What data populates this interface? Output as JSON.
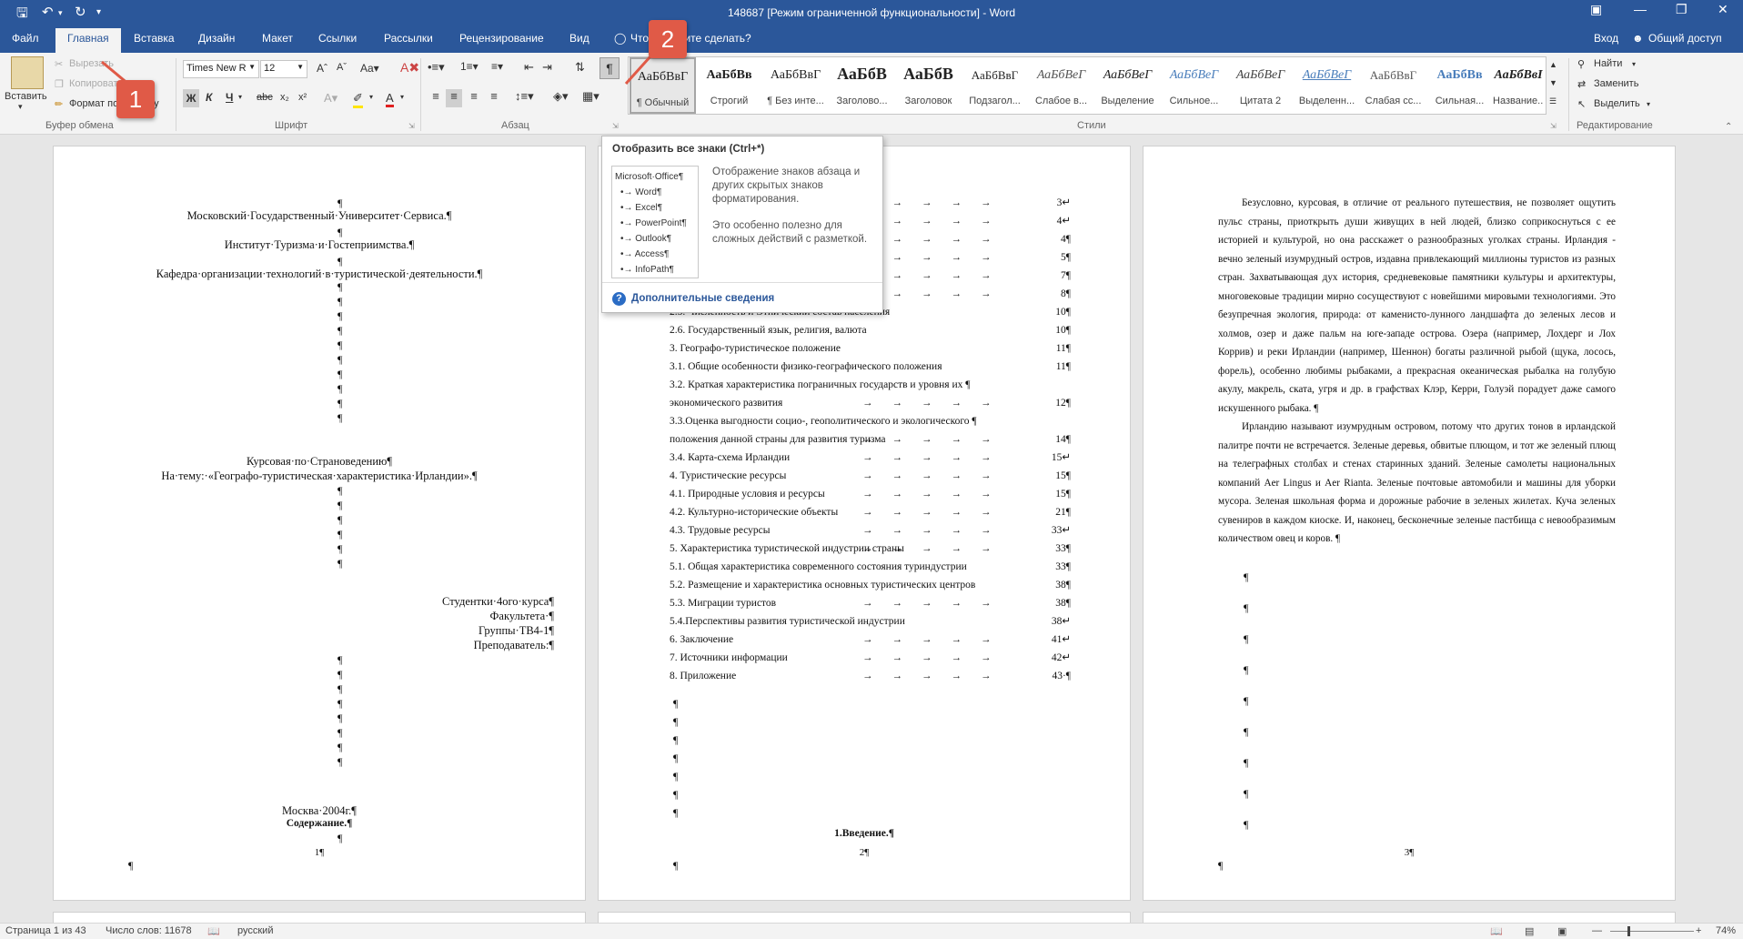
{
  "window": {
    "title": "148687 [Режим ограниченной функциональности] - Word"
  },
  "qat": {
    "save_icon": "save-icon",
    "undo_icon": "undo-icon",
    "redo_icon": "redo-icon"
  },
  "tabs": [
    {
      "label": "Файл"
    },
    {
      "label": "Главная"
    },
    {
      "label": "Вставка"
    },
    {
      "label": "Дизайн"
    },
    {
      "label": "Макет"
    },
    {
      "label": "Ссылки"
    },
    {
      "label": "Рассылки"
    },
    {
      "label": "Рецензирование"
    },
    {
      "label": "Вид"
    }
  ],
  "tell_me": "Что вы хотите сделать?",
  "signin": "Вход",
  "share": "Общий доступ",
  "clipboard": {
    "paste": "Вставить",
    "cut": "Вырезать",
    "copy": "Копировать",
    "format_painter": "Формат по образцу",
    "group": "Буфер обмена"
  },
  "font": {
    "name": "Times New R",
    "size": "12",
    "group": "Шрифт"
  },
  "paragraph": {
    "group": "Абзац"
  },
  "styles": {
    "group": "Стили",
    "items": [
      {
        "preview": "АаБбВвГ",
        "name": "¶ Обычный"
      },
      {
        "preview": "АаБбВв",
        "name": "Строгий"
      },
      {
        "preview": "АаБбВвГ",
        "name": "¶ Без инте..."
      },
      {
        "preview": "АаБбВ",
        "name": "Заголово..."
      },
      {
        "preview": "АаБбВ",
        "name": "Заголовок"
      },
      {
        "preview": "АаБбВвГ",
        "name": "Подзагол..."
      },
      {
        "preview": "АаБбВеГ",
        "name": "Слабое в..."
      },
      {
        "preview": "АаБбВеГ",
        "name": "Выделение"
      },
      {
        "preview": "АаБбВеГ",
        "name": "Сильное..."
      },
      {
        "preview": "АаБбВеГ",
        "name": "Цитата 2"
      },
      {
        "preview": "АаБбВеГ",
        "name": "Выделенн..."
      },
      {
        "preview": "АаБбВвГ",
        "name": "Слабая сс..."
      },
      {
        "preview": "АаБбВв",
        "name": "Сильная..."
      },
      {
        "preview": "АаБбВвІ",
        "name": "Название..."
      }
    ]
  },
  "editing": {
    "find": "Найти",
    "replace": "Заменить",
    "select": "Выделить",
    "group": "Редактирование"
  },
  "badges": {
    "one": "1",
    "two": "2"
  },
  "tooltip": {
    "header": "Отобразить все знаки (Ctrl+*)",
    "img_lines": [
      "Microsoft·Office¶",
      "•→ Word¶",
      "•→ Excel¶",
      "•→ PowerPoint¶",
      "•→ Outlook¶",
      "•→ Access¶",
      "•→ InfoPath¶"
    ],
    "desc1": "Отображение знаков абзаца и других скрытых знаков форматирования.",
    "desc2": "Это особенно полезно для сложных действий с разметкой.",
    "more": "Дополнительные сведения"
  },
  "page1": {
    "univ": "Московский·Государственный·Университет·Сервиса.¶",
    "inst": "Институт·Туризма·и·Гостеприимства.¶",
    "dept": "Кафедра·организации·технологий·в·туристической·деятельности.¶",
    "course": "Курсовая·по·Страноведению¶",
    "topic": "На·тему:·«Географо-туристическая·характеристика·Ирландии».¶",
    "student": "Студентки·4ого·курса¶",
    "faculty": "Факультета·¶",
    "group_l": "Группы·ТВ4-1¶",
    "teacher": "Преподаватель:¶",
    "city": "Москва·2004г.¶",
    "contents": "Содержание.¶",
    "pgnum": "1¶",
    "pm": "¶"
  },
  "page2": {
    "toc": [
      {
        "t": "",
        "n": "3↵"
      },
      {
        "t": "",
        "n": "4↵"
      },
      {
        "t": "",
        "n": "4¶"
      },
      {
        "t": "",
        "n": "5¶"
      },
      {
        "t": "",
        "n": "7¶"
      },
      {
        "t": "",
        "n": "8¶"
      },
      {
        "t": "2.5. Численность и Этнический состав населения",
        "n": "10¶"
      },
      {
        "t": "2.6. Государственный язык, религия, валюта",
        "n": "10¶"
      },
      {
        "t": "3. Географо-туристическое положение",
        "n": "11¶"
      },
      {
        "t": "3.1. Общие особенности физико-географического положения",
        "n": "11¶"
      },
      {
        "t": "3.2. Краткая характеристика пограничных государств и уровня их ¶",
        "n": ""
      },
      {
        "t": "экономического развития",
        "n": "12¶"
      },
      {
        "t": "3.3.Оценка выгодности социо-, геополитического и экологического ¶",
        "n": ""
      },
      {
        "t": "положения данной страны для развития туризма",
        "n": "14¶"
      },
      {
        "t": "3.4. Карта-схема Ирландии",
        "n": "15↵"
      },
      {
        "t": "4. Туристические ресурсы",
        "n": "15¶"
      },
      {
        "t": "4.1. Природные условия и ресурсы",
        "n": "15¶"
      },
      {
        "t": "4.2. Культурно-исторические объекты",
        "n": "21¶"
      },
      {
        "t": "4.3. Трудовые ресурсы",
        "n": "33↵"
      },
      {
        "t": "5. Характеристика туристической индустрии страны",
        "n": "33¶"
      },
      {
        "t": "5.1. Общая характеристика современного состояния туриндустрии",
        "n": "33¶"
      },
      {
        "t": "5.2. Размещение и характеристика основных туристических центров",
        "n": "38¶"
      },
      {
        "t": "5.3. Миграции туристов",
        "n": "38¶"
      },
      {
        "t": "5.4.Перспективы развития туристической индустрии",
        "n": "38↵"
      },
      {
        "t": "6. Заключение",
        "n": "41↵"
      },
      {
        "t": "7. Источники информации",
        "n": "42↵"
      },
      {
        "t": "8. Приложение",
        "n": "43·¶"
      }
    ],
    "intro": "1.Введение.¶",
    "pgnum": "2¶",
    "pm": "¶"
  },
  "page3": {
    "p1": "Безусловно, курсовая, в отличие от реального путешествия, не позволяет ощутить пульс страны, приоткрыть души живущих в ней людей, близко соприкоснуться с ее историей и культурой, но она расскажет о разнообразных уголках страны. Ирландия - вечно зеленый изумрудный остров, издавна привлекающий миллионы туристов из разных стран. Захватывающая дух история, средневековые памятники культуры и архитектуры, многовековые традиции мирно сосуществуют с новейшими мировыми технологиями. Это безупречная экология, природа: от каменисто-лунного ландшафта до зеленых лесов и холмов, озер и даже пальм на юге-западе острова. Озера (например, Лохдерг и Лох Коррив) и реки Ирландии (например, Шеннон) богаты различной рыбой (щука, лосось, форель), особенно любимы рыбаками, а прекрасная океаническая рыбалка на голубую акулу, макрель, ската, угря и др. в графствах Клэр, Керри, Голуэй порадует даже самого искушенного рыбака. ¶",
    "p2": "Ирландию называют изумрудным островом, потому что других тонов в ирландской палитре почти не встречается. Зеленые деревья, обвитые плющом, и тот же зеленый плющ на телеграфных столбах и стенах старинных зданий. Зеленые самолеты национальных компаний Aer Lingus и Aer Rianta. Зеленые почтовые автомобили и машины для уборки мусора. Зеленая школьная форма и дорожные рабочие в зеленых жилетах. Куча зеленых сувениров в каждом киоске. И, наконец, бесконечные зеленые пастбища с невообразимым количеством овец и коров. ¶",
    "pgnum": "3¶",
    "pm": "¶"
  },
  "status": {
    "page": "Страница 1 из 43",
    "words": "Число слов: 11678",
    "lang": "русский",
    "zoom": "74%"
  }
}
